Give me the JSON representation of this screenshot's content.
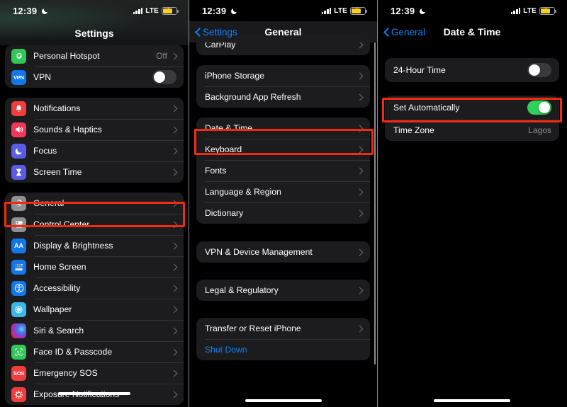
{
  "status_bar": {
    "time": "12:39",
    "moon_icon": "crescent-moon-icon",
    "signal_icon": "cellular-bars-icon",
    "network": "LTE",
    "battery_icon": "battery-charging-low-power-icon"
  },
  "panel1": {
    "nav_title": "Settings",
    "groups": [
      {
        "rows": [
          {
            "icon": "personal-hotspot-icon",
            "label": "Personal Hotspot",
            "value": "Off",
            "accessory": "chevron"
          },
          {
            "icon": "vpn-icon",
            "label": "VPN",
            "value": "",
            "accessory": "toggle-off"
          }
        ]
      },
      {
        "rows": [
          {
            "icon": "notifications-icon",
            "label": "Notifications",
            "value": "",
            "accessory": "chevron"
          },
          {
            "icon": "sounds-haptics-icon",
            "label": "Sounds & Haptics",
            "value": "",
            "accessory": "chevron"
          },
          {
            "icon": "focus-icon",
            "label": "Focus",
            "value": "",
            "accessory": "chevron"
          },
          {
            "icon": "screen-time-icon",
            "label": "Screen Time",
            "value": "",
            "accessory": "chevron"
          }
        ]
      },
      {
        "rows": [
          {
            "icon": "general-gear-icon",
            "label": "General",
            "value": "",
            "accessory": "chevron"
          },
          {
            "icon": "control-center-icon",
            "label": "Control Center",
            "value": "",
            "accessory": "chevron"
          },
          {
            "icon": "display-brightness-icon",
            "label": "Display & Brightness",
            "value": "",
            "accessory": "chevron"
          },
          {
            "icon": "home-screen-icon",
            "label": "Home Screen",
            "value": "",
            "accessory": "chevron"
          },
          {
            "icon": "accessibility-icon",
            "label": "Accessibility",
            "value": "",
            "accessory": "chevron"
          },
          {
            "icon": "wallpaper-icon",
            "label": "Wallpaper",
            "value": "",
            "accessory": "chevron"
          },
          {
            "icon": "siri-search-icon",
            "label": "Siri & Search",
            "value": "",
            "accessory": "chevron"
          },
          {
            "icon": "face-id-passcode-icon",
            "label": "Face ID & Passcode",
            "value": "",
            "accessory": "chevron"
          },
          {
            "icon": "emergency-sos-icon",
            "label": "Emergency SOS",
            "value": "",
            "accessory": "chevron"
          },
          {
            "icon": "exposure-notifications-icon",
            "label": "Exposure Notifications",
            "value": "",
            "accessory": "chevron"
          }
        ]
      }
    ],
    "highlight": "General"
  },
  "panel2": {
    "nav_back": "Settings",
    "nav_title": "General",
    "groups": [
      {
        "rows": [
          {
            "label": "CarPlay",
            "value": "",
            "accessory": "chevron"
          }
        ]
      },
      {
        "rows": [
          {
            "label": "iPhone Storage",
            "value": "",
            "accessory": "chevron"
          },
          {
            "label": "Background App Refresh",
            "value": "",
            "accessory": "chevron"
          }
        ]
      },
      {
        "rows": [
          {
            "label": "Date & Time",
            "value": "",
            "accessory": "chevron"
          },
          {
            "label": "Keyboard",
            "value": "",
            "accessory": "chevron"
          },
          {
            "label": "Fonts",
            "value": "",
            "accessory": "chevron"
          },
          {
            "label": "Language & Region",
            "value": "",
            "accessory": "chevron"
          },
          {
            "label": "Dictionary",
            "value": "",
            "accessory": "chevron"
          }
        ]
      },
      {
        "rows": [
          {
            "label": "VPN & Device Management",
            "value": "",
            "accessory": "chevron"
          }
        ]
      },
      {
        "rows": [
          {
            "label": "Legal & Regulatory",
            "value": "",
            "accessory": "chevron"
          }
        ]
      },
      {
        "rows": [
          {
            "label": "Transfer or Reset iPhone",
            "value": "",
            "accessory": "chevron"
          },
          {
            "label": "Shut Down",
            "value": "",
            "accessory": "none",
            "style": "blue"
          }
        ]
      }
    ],
    "highlight": "Date & Time"
  },
  "panel3": {
    "nav_back": "General",
    "nav_title": "Date & Time",
    "groups": [
      {
        "rows": [
          {
            "label": "24-Hour Time",
            "value": "",
            "accessory": "toggle-off"
          }
        ]
      },
      {
        "rows": [
          {
            "label": "Set Automatically",
            "value": "",
            "accessory": "toggle-on"
          },
          {
            "label": "Time Zone",
            "value": "Lagos",
            "accessory": "none"
          }
        ]
      }
    ],
    "highlight": "Set Automatically"
  },
  "colors": {
    "highlight_box": "#f42a10",
    "toggle_on": "#30d158",
    "toggle_off": "#3a3a3c",
    "link_blue": "#0a84ff",
    "group_bg": "#1c1c1e",
    "page_bg": "#000000",
    "secondary_text": "#8e8e93"
  }
}
